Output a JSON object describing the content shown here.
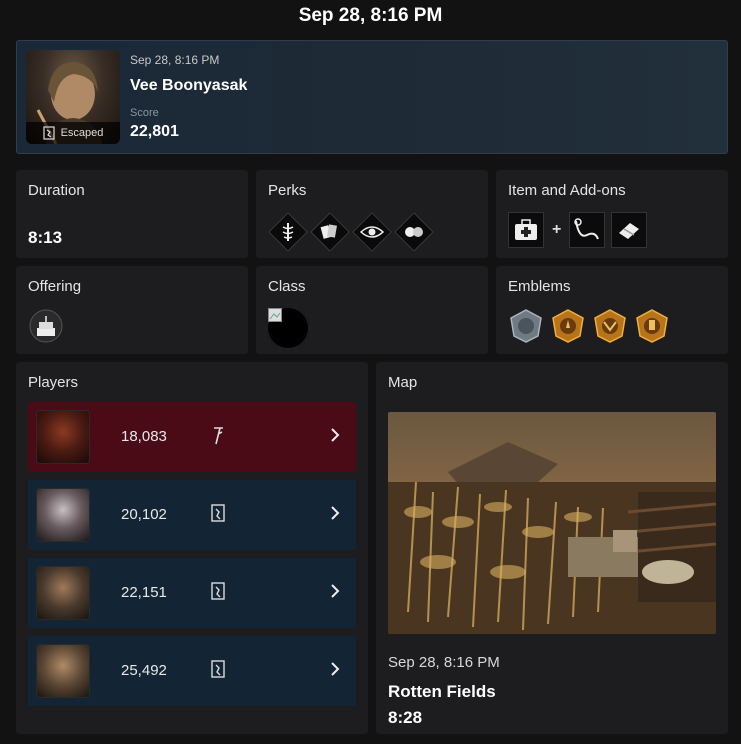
{
  "header": {
    "title": "Sep 28, 8:16 PM"
  },
  "match": {
    "date": "Sep 28, 8:16 PM",
    "character": "Vee Boonyasak",
    "score_label": "Score",
    "score": "22,801",
    "status": "Escaped"
  },
  "duration": {
    "label": "Duration",
    "value": "8:13"
  },
  "perks": {
    "label": "Perks",
    "icons": [
      "medic-perk-icon",
      "cards-perk-icon",
      "eye-perk-icon",
      "hands-perk-icon"
    ]
  },
  "items": {
    "label": "Item and Add-ons",
    "plus": "+",
    "icons": [
      "medkit-icon",
      "rope-addon-icon",
      "bandage-addon-icon"
    ]
  },
  "offering": {
    "label": "Offering",
    "icon": "cake-offering-icon"
  },
  "class": {
    "label": "Class",
    "icon": "class-image-broken"
  },
  "emblems": {
    "label": "Emblems",
    "icons": [
      "iron-emblem-icon",
      "gold-emblem-icon",
      "gold-emblem-icon",
      "gold-emblem-icon"
    ]
  },
  "players": {
    "label": "Players",
    "rows": [
      {
        "score": "18,083",
        "role": "killer",
        "status_icon": "sacrifice-icon"
      },
      {
        "score": "20,102",
        "role": "survivor",
        "status_icon": "escaped-icon"
      },
      {
        "score": "22,151",
        "role": "survivor",
        "status_icon": "escaped-icon"
      },
      {
        "score": "25,492",
        "role": "survivor",
        "status_icon": "escaped-icon"
      }
    ]
  },
  "map": {
    "label": "Map",
    "date": "Sep 28, 8:16 PM",
    "name": "Rotten Fields",
    "duration": "8:28"
  },
  "colors": {
    "background": "#121212",
    "card": "#1d1d1f",
    "killer_row": "#4a0a16",
    "survivor_row": "#132434",
    "emblem_gold": "#c9851f",
    "emblem_iron": "#8a949c"
  }
}
